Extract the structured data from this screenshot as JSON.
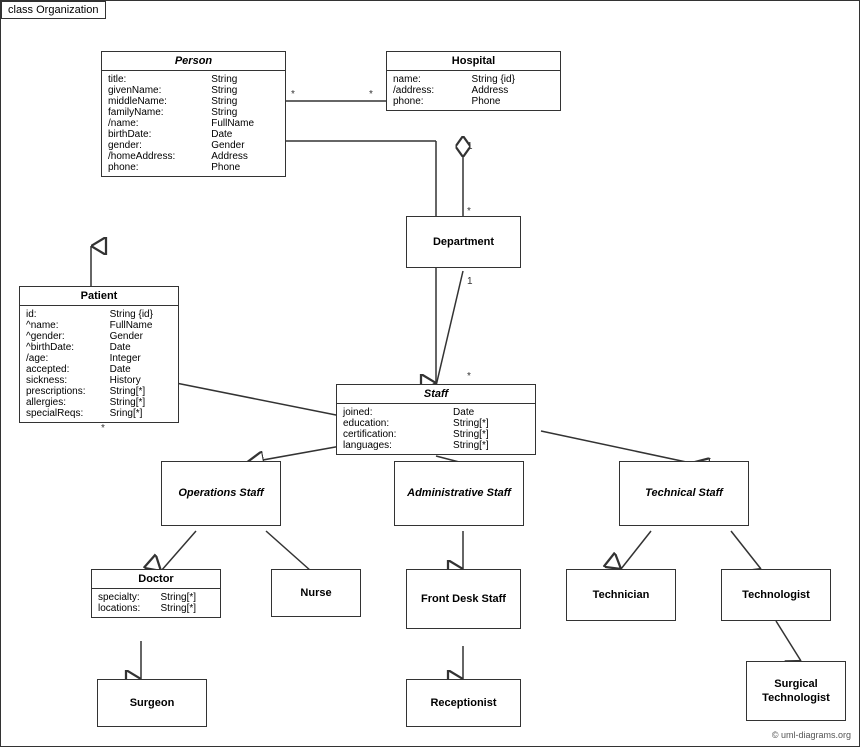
{
  "diagram": {
    "title": "class Organization",
    "copyright": "© uml-diagrams.org",
    "classes": {
      "person": {
        "name": "Person",
        "italic": true,
        "attributes": [
          [
            "title:",
            "String"
          ],
          [
            "givenName:",
            "String"
          ],
          [
            "middleName:",
            "String"
          ],
          [
            "familyName:",
            "String"
          ],
          [
            "/name:",
            "FullName"
          ],
          [
            "birthDate:",
            "Date"
          ],
          [
            "gender:",
            "Gender"
          ],
          [
            "/homeAddress:",
            "Address"
          ],
          [
            "phone:",
            "Phone"
          ]
        ]
      },
      "hospital": {
        "name": "Hospital",
        "italic": false,
        "attributes": [
          [
            "name:",
            "String {id}"
          ],
          [
            "/address:",
            "Address"
          ],
          [
            "phone:",
            "Phone"
          ]
        ]
      },
      "patient": {
        "name": "Patient",
        "italic": false,
        "attributes": [
          [
            "id:",
            "String {id}"
          ],
          [
            "^name:",
            "FullName"
          ],
          [
            "^gender:",
            "Gender"
          ],
          [
            "^birthDate:",
            "Date"
          ],
          [
            "/age:",
            "Integer"
          ],
          [
            "accepted:",
            "Date"
          ],
          [
            "sickness:",
            "History"
          ],
          [
            "prescriptions:",
            "String[*]"
          ],
          [
            "allergies:",
            "String[*]"
          ],
          [
            "specialReqs:",
            "Sring[*]"
          ]
        ]
      },
      "department": {
        "name": "Department",
        "italic": false
      },
      "staff": {
        "name": "Staff",
        "italic": true,
        "attributes": [
          [
            "joined:",
            "Date"
          ],
          [
            "education:",
            "String[*]"
          ],
          [
            "certification:",
            "String[*]"
          ],
          [
            "languages:",
            "String[*]"
          ]
        ]
      },
      "operations_staff": {
        "name": "Operations Staff",
        "italic": true
      },
      "admin_staff": {
        "name": "Administrative Staff",
        "italic": true
      },
      "tech_staff": {
        "name": "Technical Staff",
        "italic": true
      },
      "doctor": {
        "name": "Doctor",
        "attributes": [
          [
            "specialty:",
            "String[*]"
          ],
          [
            "locations:",
            "String[*]"
          ]
        ]
      },
      "nurse": {
        "name": "Nurse"
      },
      "front_desk": {
        "name": "Front Desk Staff"
      },
      "technician": {
        "name": "Technician"
      },
      "technologist": {
        "name": "Technologist"
      },
      "surgeon": {
        "name": "Surgeon"
      },
      "receptionist": {
        "name": "Receptionist"
      },
      "surgical_tech": {
        "name": "Surgical Technologist"
      }
    }
  }
}
